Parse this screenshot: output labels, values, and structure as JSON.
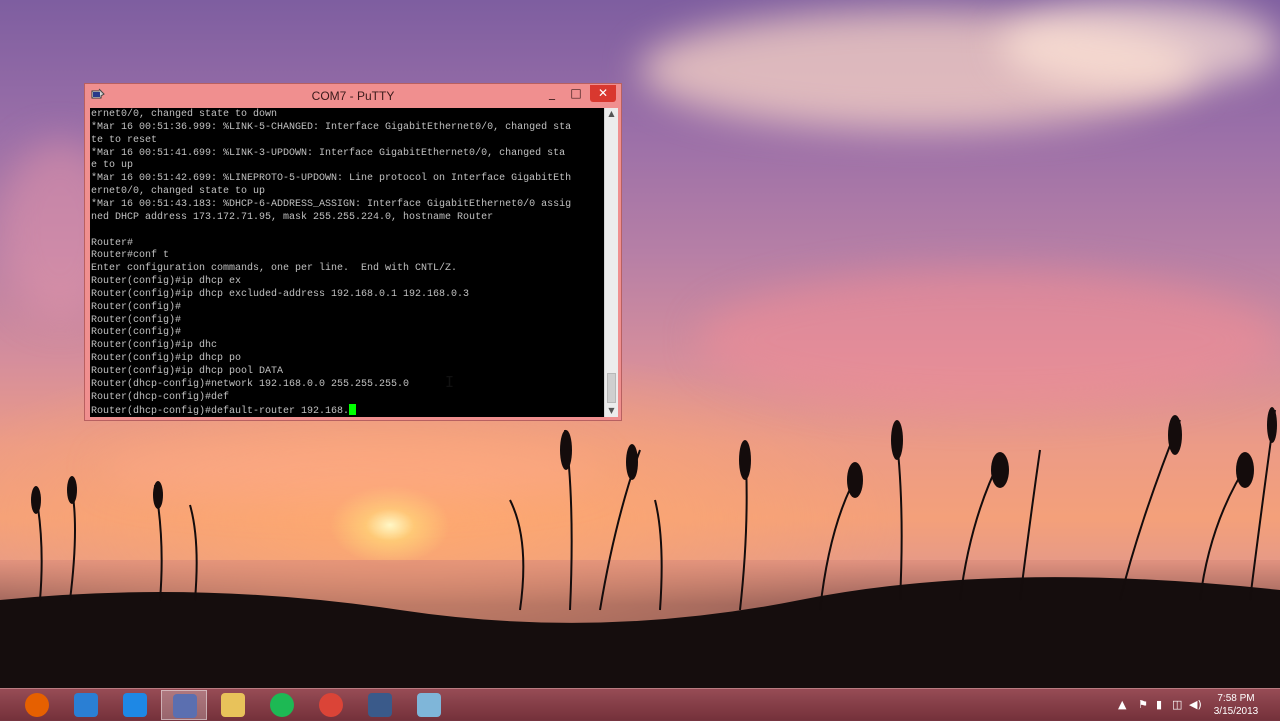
{
  "window": {
    "title": "COM7 - PuTTY",
    "minimize_glyph": "_",
    "maximize_glyph": "□",
    "close_glyph": "✕",
    "icon": "putty-icon"
  },
  "terminal": {
    "lines": [
      "ernet0/0, changed state to down",
      "*Mar 16 00:51:36.999: %LINK-5-CHANGED: Interface GigabitEthernet0/0, changed sta",
      "te to reset",
      "*Mar 16 00:51:41.699: %LINK-3-UPDOWN: Interface GigabitEthernet0/0, changed sta",
      "e to up",
      "*Mar 16 00:51:42.699: %LINEPROTO-5-UPDOWN: Line protocol on Interface GigabitEth",
      "ernet0/0, changed state to up",
      "*Mar 16 00:51:43.183: %DHCP-6-ADDRESS_ASSIGN: Interface GigabitEthernet0/0 assig",
      "ned DHCP address 173.172.71.95, mask 255.255.224.0, hostname Router",
      "",
      "Router#",
      "Router#conf t",
      "Enter configuration commands, one per line.  End with CNTL/Z.",
      "Router(config)#ip dhcp ex",
      "Router(config)#ip dhcp excluded-address 192.168.0.1 192.168.0.3",
      "Router(config)#",
      "Router(config)#",
      "Router(config)#",
      "Router(config)#ip dhc",
      "Router(config)#ip dhcp po",
      "Router(config)#ip dhcp pool DATA",
      "Router(dhcp-config)#network 192.168.0.0 255.255.255.0",
      "Router(dhcp-config)#def",
      "Router(dhcp-config)#default-router 192.168."
    ],
    "text_color": "#c0c0c0",
    "cursor_color": "#00ff00"
  },
  "taskbar": {
    "apps": [
      {
        "name": "firefox-icon",
        "color": "#e66000",
        "active": false
      },
      {
        "name": "remote-desktop-icon",
        "color": "#2a7fd4",
        "active": false
      },
      {
        "name": "internet-explorer-icon",
        "color": "#1e88e5",
        "active": false
      },
      {
        "name": "putty-icon",
        "color": "#5b6fb0",
        "active": true
      },
      {
        "name": "file-explorer-icon",
        "color": "#e8c25a",
        "active": false
      },
      {
        "name": "spotify-icon",
        "color": "#1db954",
        "active": false
      },
      {
        "name": "chrome-icon",
        "color": "#db4437",
        "active": false
      },
      {
        "name": "solarwinds-icon",
        "color": "#3a5a8a",
        "active": false
      },
      {
        "name": "notepad-icon",
        "color": "#7fb6d9",
        "active": false
      }
    ],
    "tray_icons": [
      "chevron-up-icon",
      "flag-icon",
      "device-icon",
      "network-icon",
      "volume-icon",
      "keyboard-icon"
    ],
    "clock": {
      "time": "7:58 PM",
      "date": "3/15/2013"
    }
  }
}
